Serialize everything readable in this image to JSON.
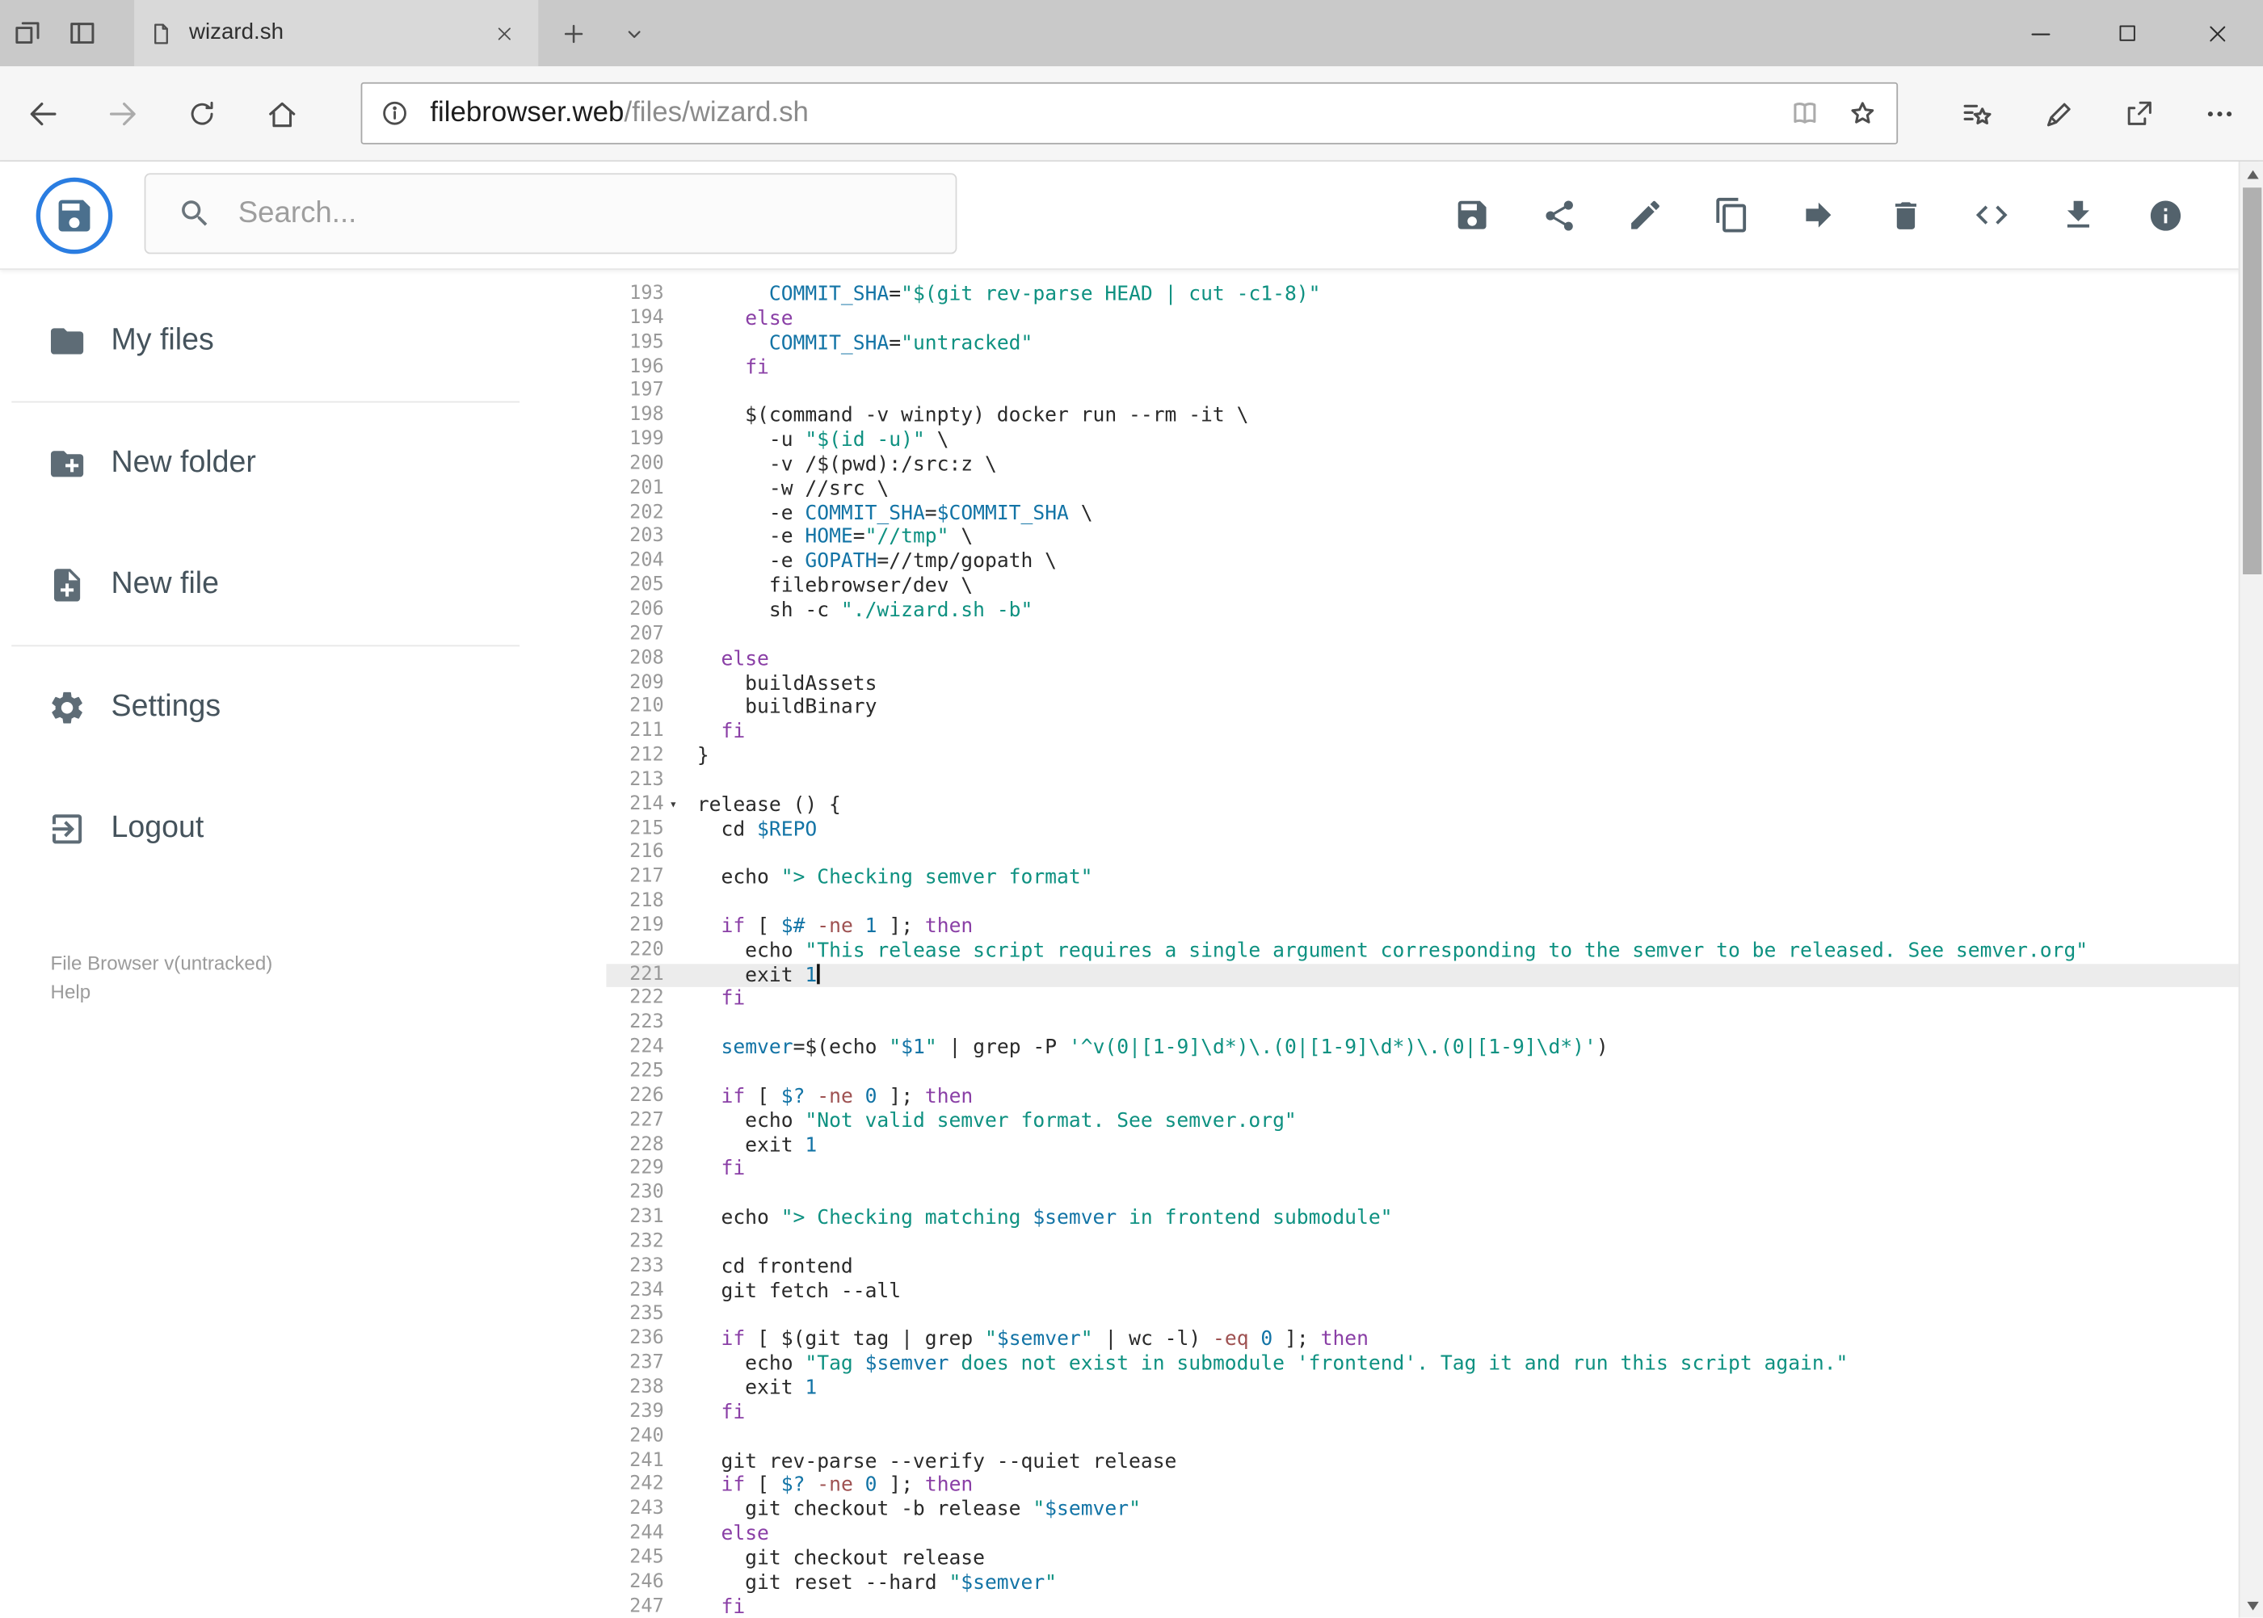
{
  "browser": {
    "tabstrip_icons": [
      "set-tabs-aside-icon",
      "tab-preview-icon"
    ],
    "tab": {
      "title": "wizard.sh",
      "favicon": "page-icon",
      "close": "close-icon"
    },
    "new_tab_icon": "plus-icon",
    "tab_dropdown_icon": "chevron-down-icon",
    "window_controls": [
      "minimize-icon",
      "maximize-icon",
      "close-icon"
    ],
    "nav_icons": [
      "back-icon",
      "forward-icon",
      "refresh-icon",
      "home-icon"
    ],
    "address": {
      "info_icon": "info-icon",
      "host": "filebrowser.web",
      "path": "/files/wizard.sh",
      "reading_view_icon": "book-icon",
      "favorite_icon": "star-icon"
    },
    "right_icons": [
      "hub-icon",
      "web-note-icon",
      "share-icon",
      "more-icon"
    ]
  },
  "header": {
    "logo_icon": "floppy-disk-icon",
    "search_placeholder": "Search...",
    "actions": [
      "save-icon",
      "share-icon",
      "rename-icon",
      "copy-icon",
      "move-icon",
      "delete-icon",
      "code-icon",
      "download-icon",
      "info-icon"
    ]
  },
  "sidebar": {
    "items": [
      {
        "label": "My files",
        "icon": "folder-icon"
      },
      {
        "label": "New folder",
        "icon": "new-folder-icon"
      },
      {
        "label": "New file",
        "icon": "new-file-icon"
      },
      {
        "label": "Settings",
        "icon": "settings-gear-icon"
      },
      {
        "label": "Logout",
        "icon": "logout-icon"
      }
    ],
    "footer": {
      "version": "File Browser v(untracked)",
      "help": "Help"
    }
  },
  "editor": {
    "active_line": 221,
    "fold_line": 214,
    "lines": [
      {
        "n": 193,
        "t": "      COMMIT_SHA=\"$(git rev-parse HEAD | cut -c1-8)\""
      },
      {
        "n": 194,
        "t": "    else"
      },
      {
        "n": 195,
        "t": "      COMMIT_SHA=\"untracked\""
      },
      {
        "n": 196,
        "t": "    fi"
      },
      {
        "n": 197,
        "t": ""
      },
      {
        "n": 198,
        "t": "    $(command -v winpty) docker run --rm -it \\"
      },
      {
        "n": 199,
        "t": "      -u \"$(id -u)\" \\"
      },
      {
        "n": 200,
        "t": "      -v /$(pwd):/src:z \\"
      },
      {
        "n": 201,
        "t": "      -w //src \\"
      },
      {
        "n": 202,
        "t": "      -e COMMIT_SHA=$COMMIT_SHA \\"
      },
      {
        "n": 203,
        "t": "      -e HOME=\"//tmp\" \\"
      },
      {
        "n": 204,
        "t": "      -e GOPATH=//tmp/gopath \\"
      },
      {
        "n": 205,
        "t": "      filebrowser/dev \\"
      },
      {
        "n": 206,
        "t": "      sh -c \"./wizard.sh -b\""
      },
      {
        "n": 207,
        "t": ""
      },
      {
        "n": 208,
        "t": "  else"
      },
      {
        "n": 209,
        "t": "    buildAssets"
      },
      {
        "n": 210,
        "t": "    buildBinary"
      },
      {
        "n": 211,
        "t": "  fi"
      },
      {
        "n": 212,
        "t": "}"
      },
      {
        "n": 213,
        "t": ""
      },
      {
        "n": 214,
        "t": "release () {"
      },
      {
        "n": 215,
        "t": "  cd $REPO"
      },
      {
        "n": 216,
        "t": ""
      },
      {
        "n": 217,
        "t": "  echo \"> Checking semver format\""
      },
      {
        "n": 218,
        "t": ""
      },
      {
        "n": 219,
        "t": "  if [ $# -ne 1 ]; then"
      },
      {
        "n": 220,
        "t": "    echo \"This release script requires a single argument corresponding to the semver to be released. See semver.org\""
      },
      {
        "n": 221,
        "t": "    exit 1"
      },
      {
        "n": 222,
        "t": "  fi"
      },
      {
        "n": 223,
        "t": ""
      },
      {
        "n": 224,
        "t": "  semver=$(echo \"$1\" | grep -P '^v(0|[1-9]\\d*)\\.(0|[1-9]\\d*)\\.(0|[1-9]\\d*)')"
      },
      {
        "n": 225,
        "t": ""
      },
      {
        "n": 226,
        "t": "  if [ $? -ne 0 ]; then"
      },
      {
        "n": 227,
        "t": "    echo \"Not valid semver format. See semver.org\""
      },
      {
        "n": 228,
        "t": "    exit 1"
      },
      {
        "n": 229,
        "t": "  fi"
      },
      {
        "n": 230,
        "t": ""
      },
      {
        "n": 231,
        "t": "  echo \"> Checking matching $semver in frontend submodule\""
      },
      {
        "n": 232,
        "t": ""
      },
      {
        "n": 233,
        "t": "  cd frontend"
      },
      {
        "n": 234,
        "t": "  git fetch --all"
      },
      {
        "n": 235,
        "t": ""
      },
      {
        "n": 236,
        "t": "  if [ $(git tag | grep \"$semver\" | wc -l) -eq 0 ]; then"
      },
      {
        "n": 237,
        "t": "    echo \"Tag $semver does not exist in submodule 'frontend'. Tag it and run this script again.\""
      },
      {
        "n": 238,
        "t": "    exit 1"
      },
      {
        "n": 239,
        "t": "  fi"
      },
      {
        "n": 240,
        "t": ""
      },
      {
        "n": 241,
        "t": "  git rev-parse --verify --quiet release"
      },
      {
        "n": 242,
        "t": "  if [ $? -ne 0 ]; then"
      },
      {
        "n": 243,
        "t": "    git checkout -b release \"$semver\""
      },
      {
        "n": 244,
        "t": "  else"
      },
      {
        "n": 245,
        "t": "    git checkout release"
      },
      {
        "n": 246,
        "t": "    git reset --hard \"$semver\""
      },
      {
        "n": 247,
        "t": "  fi"
      }
    ]
  },
  "colors": {
    "keyword": "#8a3fa6",
    "string": "#0e9181",
    "variable": "#1374a6",
    "number": "#1374a6",
    "test_op": "#9e5151",
    "accent_blue": "#2a7de1",
    "toolbar_icon": "#53626c",
    "active_line_bg": "#ececec"
  }
}
